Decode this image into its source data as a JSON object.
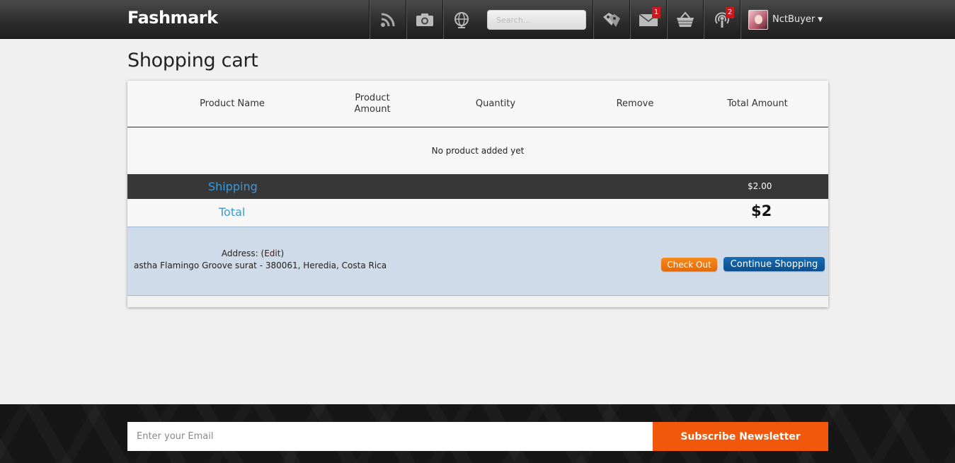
{
  "header": {
    "brand": "Fashmark",
    "search_placeholder": "Search...",
    "messages_badge": "1",
    "notifications_badge": "2",
    "username": "NctBuyer",
    "nav_icons": [
      "rss-icon",
      "camera-icon",
      "globe-icon",
      "tags-icon",
      "mail-icon",
      "basket-icon",
      "podcast-icon"
    ]
  },
  "page": {
    "title": "Shopping cart"
  },
  "cart": {
    "columns": [
      "Product Name",
      "Product Amount",
      "Quantity",
      "Remove",
      "Total Amount"
    ],
    "empty_message": "No product added yet",
    "shipping_label": "Shipping",
    "shipping_value": "$2.00",
    "total_label": "Total",
    "total_value": "$2",
    "address_label": "Address: (",
    "address_edit": "Edit",
    "address_close": ")",
    "address_text": "astha Flamingo Groove surat - 380061, Heredia, Costa Rica",
    "checkout_label": "Check Out",
    "continue_label": "Continue Shopping"
  },
  "footer": {
    "email_placeholder": "Enter your Email",
    "subscribe_label": "Subscribe Newsletter"
  },
  "colors": {
    "accent_blue": "#3a9ad9",
    "checkout_orange": "#e46a0b",
    "continue_blue": "#0b4f8d",
    "subscribe_orange": "#f1580c",
    "badge_red": "#c8191c"
  }
}
